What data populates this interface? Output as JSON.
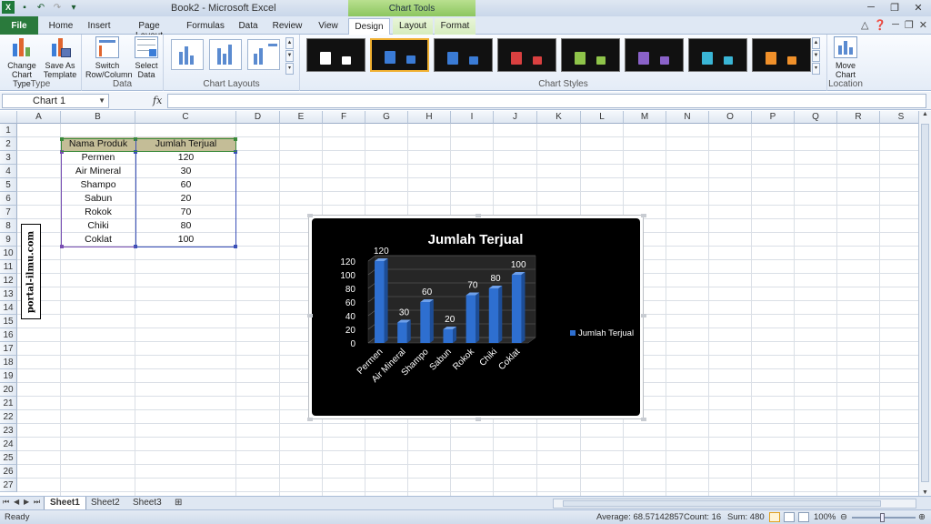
{
  "window": {
    "title": "Book2 - Microsoft Excel",
    "context_tab": "Chart Tools"
  },
  "tabs": [
    "File",
    "Home",
    "Insert",
    "Page Layout",
    "Formulas",
    "Data",
    "Review",
    "View",
    "Design",
    "Layout",
    "Format"
  ],
  "active_tab": "Design",
  "ribbon": {
    "type_group": {
      "label": "Type",
      "change_chart_type": "Change Chart Type",
      "save_as_template": "Save As Template"
    },
    "data_group": {
      "label": "Data",
      "switch_row_column": "Switch Row/Column",
      "select_data": "Select Data"
    },
    "layouts_group": {
      "label": "Chart Layouts"
    },
    "styles_group": {
      "label": "Chart Styles",
      "styles": [
        {
          "color": "#ffffff"
        },
        {
          "color": "#3a7bd5",
          "selected": true
        },
        {
          "color": "#3a7bd5"
        },
        {
          "color": "#d94040"
        },
        {
          "color": "#8fc44a"
        },
        {
          "color": "#8a62c9"
        },
        {
          "color": "#3ab6d6"
        },
        {
          "color": "#f0902a"
        }
      ]
    },
    "location_group": {
      "label": "Location",
      "move_chart": "Move Chart"
    }
  },
  "formula_bar": {
    "name_box": "Chart 1",
    "fx": "fx",
    "value": ""
  },
  "columns": [
    "A",
    "B",
    "C",
    "D",
    "E",
    "F",
    "G",
    "H",
    "I",
    "J",
    "K",
    "L",
    "M",
    "N",
    "O",
    "P",
    "Q",
    "R",
    "S"
  ],
  "rows": [
    "1",
    "2",
    "3",
    "4",
    "5",
    "6",
    "7",
    "8",
    "9",
    "10",
    "11",
    "12",
    "13",
    "14",
    "15",
    "16",
    "17",
    "18",
    "19",
    "20",
    "21",
    "22",
    "23",
    "24",
    "25",
    "26",
    "27"
  ],
  "table": {
    "headers": [
      "Nama Produk",
      "Jumlah Terjual"
    ],
    "rows": [
      [
        "Permen",
        "120"
      ],
      [
        "Air Mineral",
        "30"
      ],
      [
        "Shampo",
        "60"
      ],
      [
        "Sabun",
        "20"
      ],
      [
        "Rokok",
        "70"
      ],
      [
        "Chiki",
        "80"
      ],
      [
        "Coklat",
        "100"
      ]
    ]
  },
  "watermark": "portal-ilmu.com",
  "chart_data": {
    "type": "bar",
    "title": "Jumlah Terjual",
    "categories": [
      "Permen",
      "Air Mineral",
      "Shampo",
      "Sabun",
      "Rokok",
      "Chiki",
      "Coklat"
    ],
    "series": [
      {
        "name": "Jumlah Terjual",
        "values": [
          120,
          30,
          60,
          20,
          70,
          80,
          100
        ]
      }
    ],
    "ylim": [
      0,
      120
    ],
    "yticks": [
      "0",
      "20",
      "40",
      "60",
      "80",
      "100",
      "120"
    ],
    "xlabel": "",
    "ylabel": "",
    "grid": true,
    "legend": "right",
    "colors": {
      "bar": "#2e6fd0",
      "background": "#000000",
      "text": "#ffffff"
    }
  },
  "sheets": [
    "Sheet1",
    "Sheet2",
    "Sheet3"
  ],
  "active_sheet": "Sheet1",
  "status": {
    "ready": "Ready",
    "average": "Average: 68.57142857",
    "count": "Count: 16",
    "sum": "Sum: 480",
    "zoom": "100%"
  }
}
